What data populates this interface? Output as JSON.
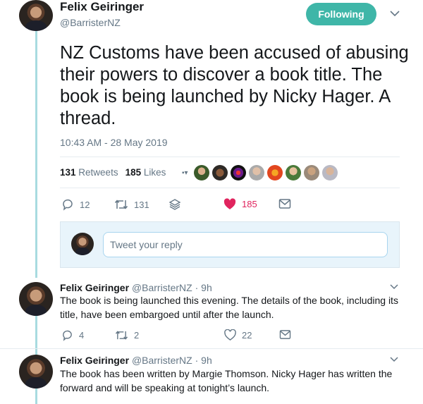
{
  "main_tweet": {
    "name": "Felix Geiringer",
    "handle": "@BarristerNZ",
    "follow_label": "Following",
    "text": "NZ Customs have been accused of abusing their powers to discover a book title. The book is being launched by Nicky Hager. A thread.",
    "timestamp": "10:43 AM - 28 May 2019",
    "retweets_count": "131",
    "retweets_label": "Retweets",
    "likes_count": "185",
    "likes_label": "Likes",
    "actions": {
      "replies": "12",
      "retweets": "131",
      "likes": "185"
    }
  },
  "reply_box": {
    "placeholder": "Tweet your reply"
  },
  "thread": [
    {
      "name": "Felix Geiringer",
      "handle": "@BarristerNZ",
      "time": "· 9h",
      "text": "The book is being launched this evening. The details of the book, including its title, have been embargoed until after the launch.",
      "replies": "4",
      "retweets": "2",
      "likes": "22"
    },
    {
      "name": "Felix Geiringer",
      "handle": "@BarristerNZ",
      "time": "· 9h",
      "text": "The book has been written by Margie Thomson. Nicky Hager has written the forward and will be speaking at tonight’s launch."
    }
  ],
  "colors": {
    "follow": "#3fb6a8",
    "like": "#e0245e",
    "thread_line": "#a8dbe0",
    "muted": "#657786"
  }
}
